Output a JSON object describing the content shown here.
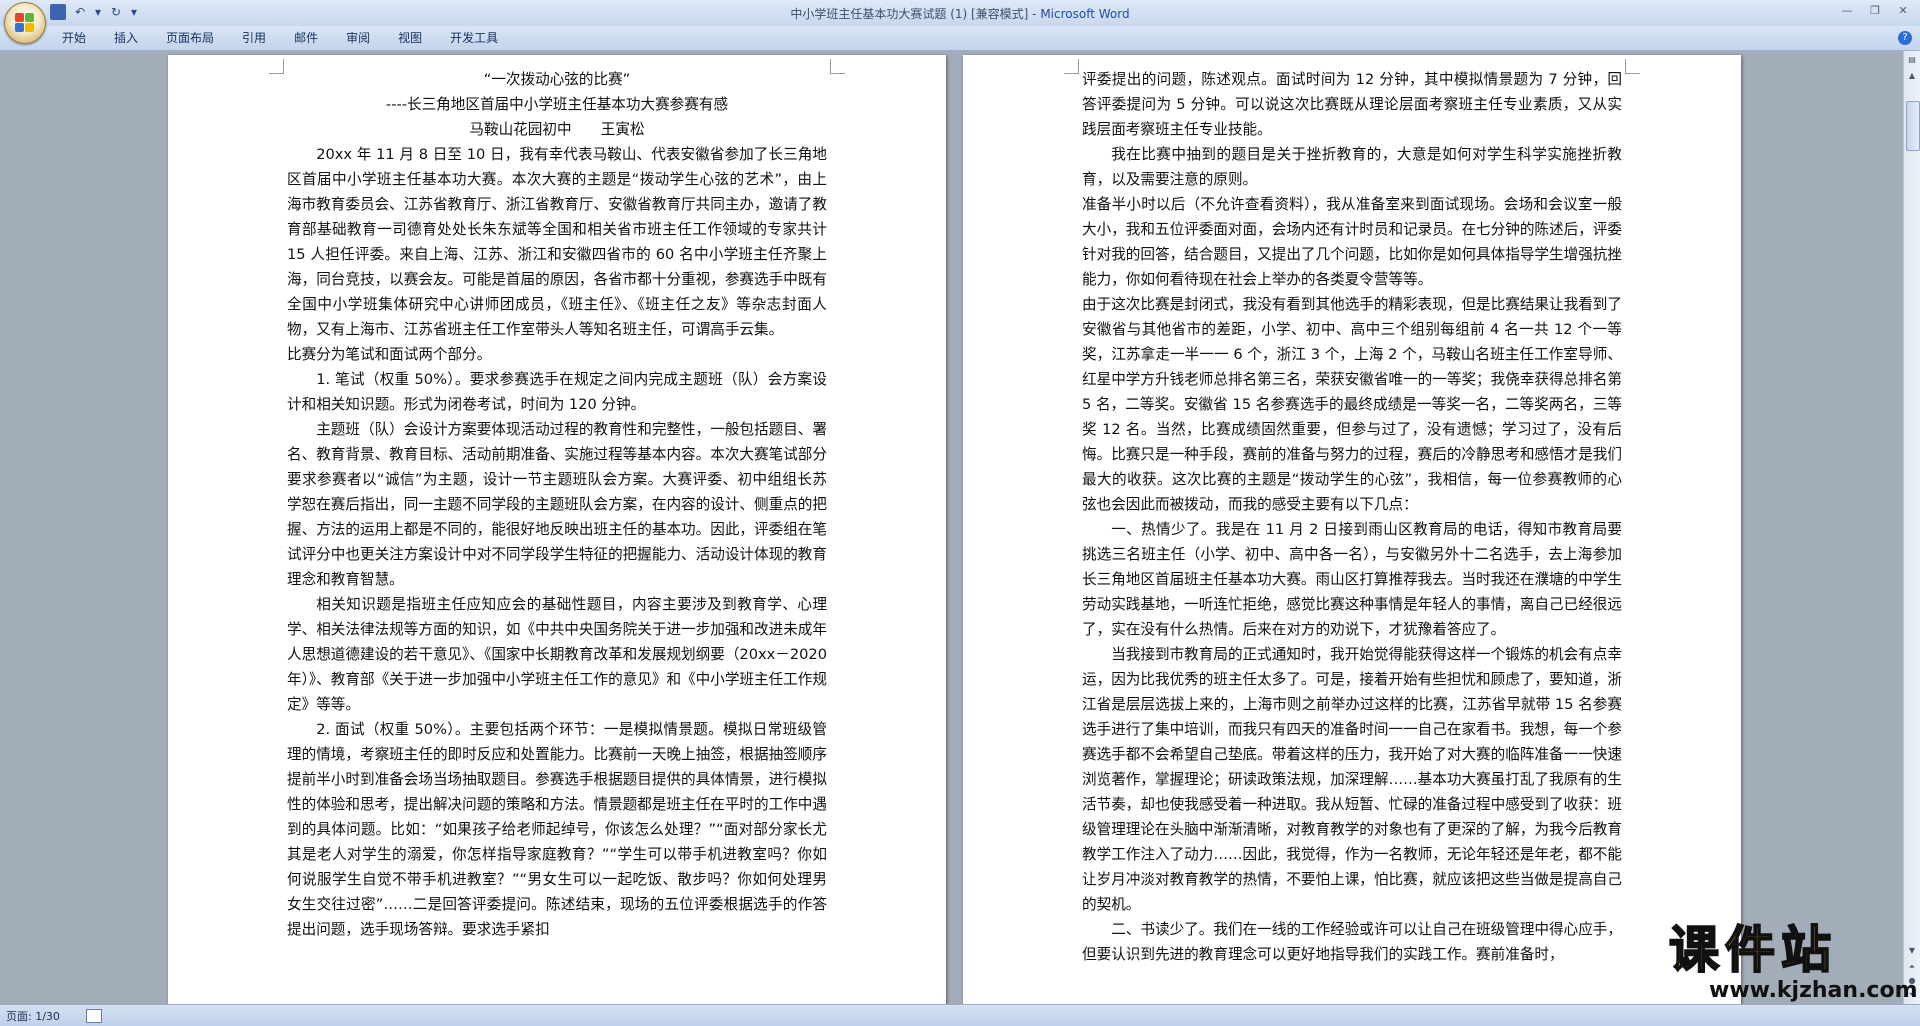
{
  "window": {
    "title_doc": "中小学班主任基本功大赛试题 (1) [兼容模式] - ",
    "title_app": "Microsoft Word"
  },
  "ribbon": {
    "tabs": [
      "开始",
      "插入",
      "页面布局",
      "引用",
      "邮件",
      "审阅",
      "视图",
      "开发工具"
    ]
  },
  "left_page": {
    "title1": "“一次拨动心弦的比赛”",
    "title2": "----长三角地区首届中小学班主任基本功大赛参赛有感",
    "author": "马鞍山花园初中　　王寅松",
    "paragraphs": [
      "20xx 年 11 月 8 日至 10 日，我有幸代表马鞍山、代表安徽省参加了长三角地区首届中小学班主任基本功大赛。本次大赛的主题是“拨动学生心弦的艺术”，由上海市教育委员会、江苏省教育厅、浙江省教育厅、安徽省教育厅共同主办，邀请了教育部基础教育一司德育处处长朱东斌等全国和相关省市班主任工作领域的专家共计 15 人担任评委。来自上海、江苏、浙江和安徽四省市的 60 名中小学班主任齐聚上海，同台竞技，以赛会友。可能是首届的原因，各省市都十分重视，参赛选手中既有全国中小学班集体研究中心讲师团成员，《班主任》、《班主任之友》等杂志封面人物，又有上海市、江苏省班主任工作室带头人等知名班主任，可谓高手云集。",
      "比赛分为笔试和面试两个部分。",
      "1. 笔试（权重 50%）。要求参赛选手在规定之间内完成主题班（队）会方案设计和相关知识题。形式为闭卷考试，时间为 120 分钟。",
      "主题班（队）会设计方案要体现活动过程的教育性和完整性，一般包括题目、署名、教育背景、教育目标、活动前期准备、实施过程等基本内容。本次大赛笔试部分要求参赛者以“诚信”为主题，设计一节主题班队会方案。大赛评委、初中组组长苏学恕在赛后指出，同一主题不同学段的主题班队会方案，在内容的设计、侧重点的把握、方法的运用上都是不同的，能很好地反映出班主任的基本功。因此，评委组在笔试评分中也更关注方案设计中对不同学段学生特征的把握能力、活动设计体现的教育理念和教育智慧。",
      "相关知识题是指班主任应知应会的基础性题目，内容主要涉及到教育学、心理学、相关法律法规等方面的知识，如《中共中央国务院关于进一步加强和改进未成年人思想道德建设的若干意见》、《国家中长期教育改革和发展规划纲要（20xx－2020 年）》、教育部《关于进一步加强中小学班主任工作的意见》和《中小学班主任工作规定》等等。",
      "2. 面试（权重 50%）。主要包括两个环节：一是模拟情景题。模拟日常班级管理的情境，考察班主任的即时反应和处置能力。比赛前一天晚上抽签，根据抽签顺序提前半小时到准备会场当场抽取题目。参赛选手根据题目提供的具体情景，进行模拟性的体验和思考，提出解决问题的策略和方法。情景题都是班主任在平时的工作中遇到的具体问题。比如：“如果孩子给老师起绰号，你该怎么处理？”“面对部分家长尤其是老人对学生的溺爱，你怎样指导家庭教育？”“学生可以带手机进教室吗？你如何说服学生自觉不带手机进教室？”“男女生可以一起吃饭、散步吗？你如何处理男女生交往过密”……二是回答评委提问。陈述结束，现场的五位评委根据选手的作答提出问题，选手现场答辩。要求选手紧扣"
    ]
  },
  "right_page": {
    "paragraphs": [
      "评委提出的问题，陈述观点。面试时间为 12 分钟，其中模拟情景题为 7 分钟，回答评委提问为 5 分钟。可以说这次比赛既从理论层面考察班主任专业素质，又从实践层面考察班主任专业技能。",
      "我在比赛中抽到的题目是关于挫折教育的，大意是如何对学生科学实施挫折教育，以及需要注意的原则。",
      "准备半小时以后（不允许查看资料），我从准备室来到面试现场。会场和会议室一般大小，我和五位评委面对面，会场内还有计时员和记录员。在七分钟的陈述后，评委针对我的回答，结合题目，又提出了几个问题，比如你是如何具体指导学生增强抗挫能力，你如何看待现在社会上举办的各类夏令营等等。",
      "由于这次比赛是封闭式，我没有看到其他选手的精彩表现，但是比赛结果让我看到了安徽省与其他省市的差距，小学、初中、高中三个组别每组前 4 名一共 12 个一等奖，江苏拿走一半一一 6 个，浙江 3 个，上海 2 个，马鞍山名班主任工作室导师、红星中学方升钱老师总排名第三名，荣获安徽省唯一的一等奖；我侥幸获得总排名第 5 名，二等奖。安徽省 15 名参赛选手的最终成绩是一等奖一名，二等奖两名，三等奖 12 名。当然，比赛成绩固然重要，但参与过了，没有遗憾；学习过了，没有后悔。比赛只是一种手段，赛前的准备与努力的过程，赛后的冷静思考和感悟才是我们最大的收获。这次比赛的主题是“拨动学生的心弦”，我相信，每一位参赛教师的心弦也会因此而被拨动，而我的感受主要有以下几点：",
      "一、热情少了。我是在 11 月 2 日接到雨山区教育局的电话，得知市教育局要挑选三名班主任（小学、初中、高中各一名），与安徽另外十二名选手，去上海参加长三角地区首届班主任基本功大赛。雨山区打算推荐我去。当时我还在濮塘的中学生劳动实践基地，一听连忙拒绝，感觉比赛这种事情是年轻人的事情，离自己已经很远了，实在没有什么热情。后来在对方的劝说下，才犹豫着答应了。",
      "当我接到市教育局的正式通知时，我开始觉得能获得这样一个锻炼的机会有点幸运，因为比我优秀的班主任太多了。可是，接着开始有些担忧和顾虑了，要知道，浙江省是层层选拔上来的，上海市则之前举办过这样的比赛，江苏省早就带 15 名参赛选手进行了集中培训，而我只有四天的准备时间一一自己在家看书。我想，每一个参赛选手都不会希望自己垫底。带着这样的压力，我开始了对大赛的临阵准备一一快速浏览著作，掌握理论；研读政策法规，加深理解……基本功大赛虽打乱了我原有的生活节奏，却也使我感受着一种进取。我从短暂、忙碌的准备过程中感受到了收获：班级管理理论在头脑中渐渐清晰，对教育教学的对象也有了更深的了解，为我今后教育教学工作注入了动力……因此，我觉得，作为一名教师，无论年轻还是年老，都不能让岁月冲淡对教育教学的热情，不要怕上课，怕比赛，就应该把这些当做是提高自己的契机。",
      "二、书读少了。我们在一线的工作经验或许可以让自己在班级管理中得心应手，但要认识到先进的教育理念可以更好地指导我们的实践工作。赛前准备时，"
    ]
  },
  "statusbar": {
    "page_info": "页面: 1/30"
  },
  "watermark": {
    "text": "课件站",
    "url": "www.kjzhan.com"
  }
}
